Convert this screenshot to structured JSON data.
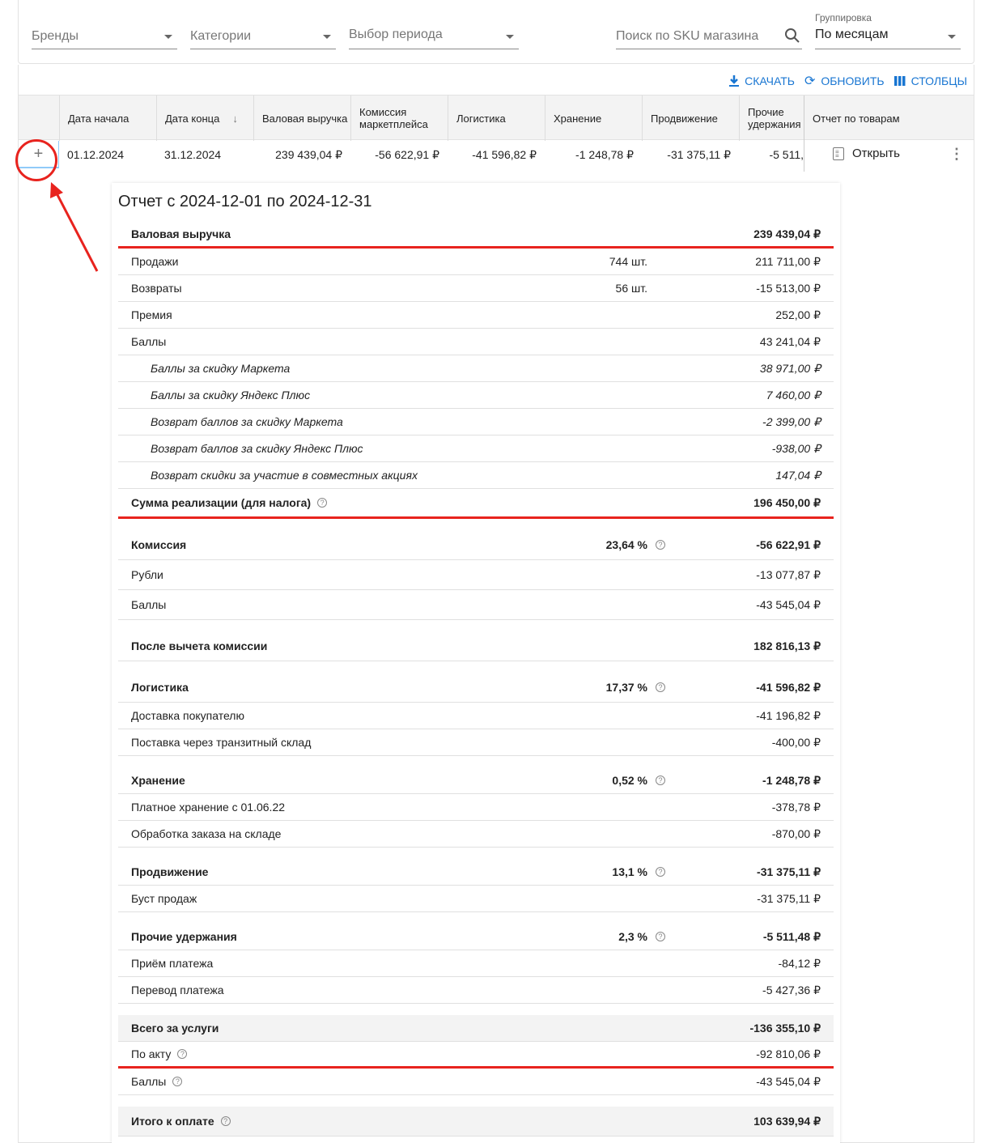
{
  "filters": {
    "brands": "Бренды",
    "categories": "Категории",
    "period": "Выбор периода",
    "search_placeholder": "Поиск по SKU магазина",
    "grouping_label": "Группировка",
    "grouping_value": "По месяцам"
  },
  "toolbar": {
    "download": "СКАЧАТЬ",
    "refresh": "ОБНОВИТЬ",
    "columns": "СТОЛБЦЫ"
  },
  "table": {
    "headers": [
      "Дата начала",
      "Дата конца",
      "Валовая выручка",
      "Комиссия маркетплейса",
      "Логистика",
      "Хранение",
      "Продвижение",
      "Прочие удержания",
      "Отчет по товарам"
    ],
    "row": {
      "start": "01.12.2024",
      "end": "31.12.2024",
      "gross": "239 439,04 ₽",
      "commission": "-56 622,91 ₽",
      "logistics": "-41 596,82 ₽",
      "storage": "-1 248,78 ₽",
      "promotion": "-31 375,11 ₽",
      "other": "-5 511,",
      "open": "Открыть"
    }
  },
  "report": {
    "title": "Отчет с 2024-12-01 по 2024-12-31",
    "sections": [
      [
        {
          "label": "Валовая выручка",
          "value": "239 439,04 ₽",
          "style": "bold hl"
        },
        {
          "label": "Продажи",
          "qty": "744 шт.",
          "value": "211 711,00 ₽"
        },
        {
          "label": "Возвраты",
          "qty": "56 шт.",
          "value": "-15 513,00 ₽"
        },
        {
          "label": "Премия",
          "value": "252,00 ₽"
        },
        {
          "label": "Баллы",
          "value": "43 241,04 ₽"
        },
        {
          "label": "Баллы за скидку Маркета",
          "value": "38 971,00 ₽",
          "style": "sub"
        },
        {
          "label": "Баллы за скидку Яндекс Плюс",
          "value": "7 460,00 ₽",
          "style": "sub"
        },
        {
          "label": "Возврат баллов за скидку Маркета",
          "value": "-2 399,00 ₽",
          "style": "sub"
        },
        {
          "label": "Возврат баллов за скидку Яндекс Плюс",
          "value": "-938,00 ₽",
          "style": "sub"
        },
        {
          "label": "Возврат скидки за участие в совместных акциях",
          "value": "147,04 ₽",
          "style": "sub"
        },
        {
          "label": "Сумма реализации (для налога)",
          "value": "196 450,00 ₽",
          "style": "bold hl tall",
          "help": true
        }
      ],
      [
        {
          "label": "Комиссия",
          "pct": "23,64 %",
          "value": "-56 622,91 ₽",
          "style": "bold tall"
        },
        {
          "label": "Рубли",
          "value": "-13 077,87 ₽",
          "style": "tall"
        },
        {
          "label": "Баллы",
          "value": "-43 545,04 ₽",
          "style": "tall"
        }
      ],
      [
        {
          "label": "После вычета комиссии",
          "value": "182 816,13 ₽",
          "style": "bold tall"
        }
      ],
      [
        {
          "label": "Логистика",
          "pct": "17,37 %",
          "value": "-41 596,82 ₽",
          "style": "bold tall"
        },
        {
          "label": "Доставка покупателю",
          "value": "-41 196,82 ₽"
        },
        {
          "label": "Поставка через транзитный склад",
          "value": "-400,00 ₽"
        }
      ],
      [
        {
          "label": "Хранение",
          "pct": "0,52 %",
          "value": "-1 248,78 ₽",
          "style": "bold"
        },
        {
          "label": "Платное хранение с 01.06.22",
          "value": "-378,78 ₽"
        },
        {
          "label": "Обработка заказа на складе",
          "value": "-870,00 ₽"
        }
      ],
      [
        {
          "label": "Продвижение",
          "pct": "13,1 %",
          "value": "-31 375,11 ₽",
          "style": "bold"
        },
        {
          "label": "Буст продаж",
          "value": "-31 375,11 ₽"
        }
      ],
      [
        {
          "label": "Прочие удержания",
          "pct": "2,3 %",
          "value": "-5 511,48 ₽",
          "style": "bold"
        },
        {
          "label": "Приём платежа",
          "value": "-84,12 ₽"
        },
        {
          "label": "Перевод платежа",
          "value": "-5 427,36 ₽"
        }
      ],
      [
        {
          "label": "Всего за услуги",
          "value": "-136 355,10 ₽",
          "style": "bold gray"
        },
        {
          "label": "По акту",
          "value": "-92 810,06 ₽",
          "style": "hl",
          "help": true
        },
        {
          "label": "Баллы",
          "value": "-43 545,04 ₽",
          "help": true
        }
      ],
      [
        {
          "label": "Итого к оплате",
          "value": "103 639,94 ₽",
          "style": "bold gray tall",
          "help": true
        }
      ]
    ]
  }
}
